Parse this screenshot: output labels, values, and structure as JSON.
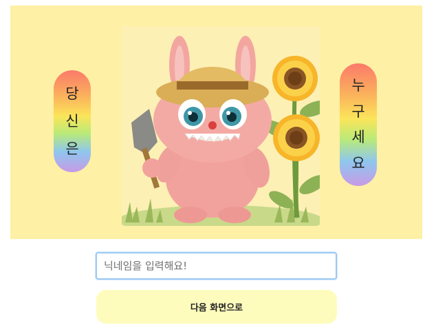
{
  "left_banner": {
    "chars": [
      "당",
      "신",
      "은"
    ]
  },
  "right_banner": {
    "chars": [
      "누",
      "구",
      "세",
      "요"
    ]
  },
  "form": {
    "nickname_placeholder": "닉네임을 입력해요!",
    "nickname_value": "",
    "next_label": "다음 화면으로"
  },
  "colors": {
    "hero_bg": "#fef0a4",
    "button_bg": "#fefcbd",
    "input_border": "#9ccaf3"
  },
  "illustration": {
    "subject": "pink-furry-monster-with-straw-hat-and-shovel",
    "props": [
      "straw-hat",
      "garden-shovel",
      "sunflowers",
      "grass"
    ]
  }
}
